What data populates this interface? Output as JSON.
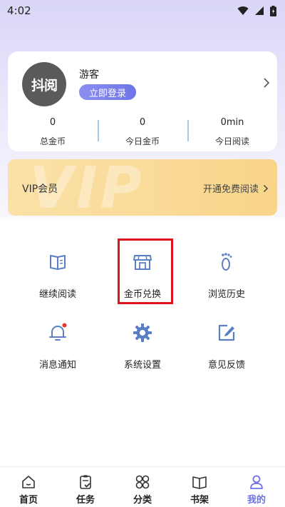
{
  "status_bar": {
    "time": "4:02"
  },
  "profile": {
    "avatar_text": "抖阅",
    "name": "游客",
    "login_label": "立即登录"
  },
  "stats": [
    {
      "value": "0",
      "label": "总金币"
    },
    {
      "value": "0",
      "label": "今日金币"
    },
    {
      "value": "0min",
      "label": "今日阅读"
    }
  ],
  "vip": {
    "watermark": "VIP",
    "title": "VIP会员",
    "action_label": "开通免费阅读"
  },
  "menu": {
    "continue_reading": "继续阅读",
    "coin_exchange": "金币兑换",
    "history": "浏览历史",
    "notifications": "消息通知",
    "settings": "系统设置",
    "feedback": "意见反馈"
  },
  "tabs": {
    "home": "首页",
    "tasks": "任务",
    "category": "分类",
    "bookshelf": "书架",
    "mine": "我的"
  },
  "colors": {
    "accent": "#6a72e6",
    "vip": "#f9d58a",
    "highlight": "#e0141c",
    "notification_dot": "#e53935"
  }
}
